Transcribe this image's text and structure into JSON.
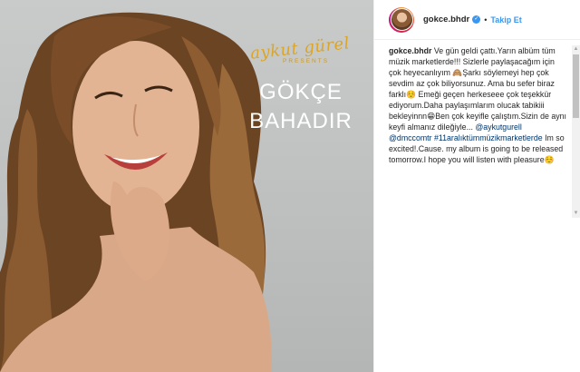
{
  "album": {
    "signature": "aykut gürel",
    "presents": "PRESENTS",
    "title_line1": "GÖKÇE",
    "title_line2": "BAHADIR"
  },
  "post": {
    "username": "gokce.bhdr",
    "separator": "•",
    "follow_label": "Takip Et",
    "caption": {
      "username": "gokce.bhdr",
      "text_1": " Ve gün geldi çattı.Yarın albüm tüm müzik marketlerde!!! Sizlerle paylaşacağım için çok heyecanlıyım 🙈Şarkı söylemeyi hep çok sevdim az çok biliyorsunuz. Ama bu sefer biraz farklı☺️ Emeği geçen herkeseee çok teşekkür ediyorum.Daha paylaşımlarım olucak tabikiii bekleyinnn😁Ben çok keyifle çalıştım.Sizin de aynı keyfi almanız dileğiyle... ",
      "mention_1": "@aykutgurell",
      "mention_2": "@dmccomtr",
      "hashtag": "#11aralıktümmüzikmarketlerde",
      "text_2": "Im so excited!.Cause. my album is going to be released tomorrow.I hope you will listen with pleasure☺️"
    }
  },
  "colors": {
    "accent": "#3897f0",
    "link": "#003569",
    "gold": "#d9a52b"
  },
  "icons": {
    "verified": "verified-badge-icon",
    "scroll_up": "scroll-up-icon",
    "scroll_down": "scroll-down-icon"
  }
}
